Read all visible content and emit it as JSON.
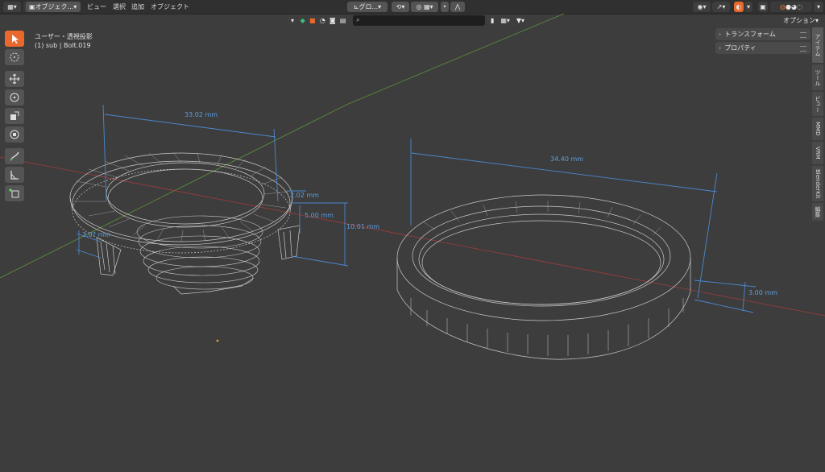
{
  "header": {
    "editor_type_icon": "view3d-icon",
    "mode_label": "オブジェク...",
    "menus": [
      "ビュー",
      "選択",
      "追加",
      "オブジェクト"
    ],
    "orientation_label": "グロ...",
    "options_label": "オプション"
  },
  "viewport": {
    "view_name": "ユーザー・透視投影",
    "object_info": "(1) sub | Bolt.019",
    "measurements": {
      "m1": "33.02 mm",
      "m2": "2.02 mm",
      "m3": "5.00 mm",
      "m4": "10.01 mm",
      "m5": "3.0? mm",
      "m6": "34.40 mm",
      "m7": "3.00 mm"
    }
  },
  "npanel": {
    "panels": [
      "トランスフォーム",
      "プロパティ"
    ]
  },
  "sidebar_tabs": [
    "アイテム",
    "ツール",
    "ビュー",
    "MMD",
    "VRM",
    "BlenderKit",
    "編集"
  ],
  "colors": {
    "accent": "#e9692c",
    "measure": "#5a9fe0",
    "x_axis": "#a33b3b",
    "y_axis": "#5b8f3a"
  }
}
